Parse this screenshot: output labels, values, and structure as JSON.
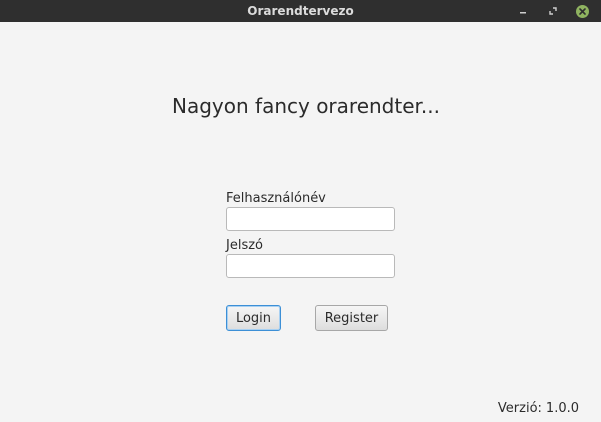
{
  "window": {
    "title": "Orarendtervezo",
    "controls": {
      "minimize_icon": "minimize-icon",
      "maximize_icon": "maximize-icon",
      "close_icon": "close-icon",
      "close_color": "#8fb360"
    }
  },
  "main": {
    "heading": "Nagyon fancy orarendter...",
    "username_label": "Felhasználónév",
    "username_value": "",
    "password_label": "Jelszó",
    "password_value": "",
    "login_label": "Login",
    "register_label": "Register"
  },
  "footer": {
    "version_label": "Verzió:",
    "version_value": "1.0.0"
  },
  "colors": {
    "titlebar_bg": "#2f2f2f",
    "window_bg": "#f4f4f4",
    "focus_accent": "#3c8fd6"
  }
}
